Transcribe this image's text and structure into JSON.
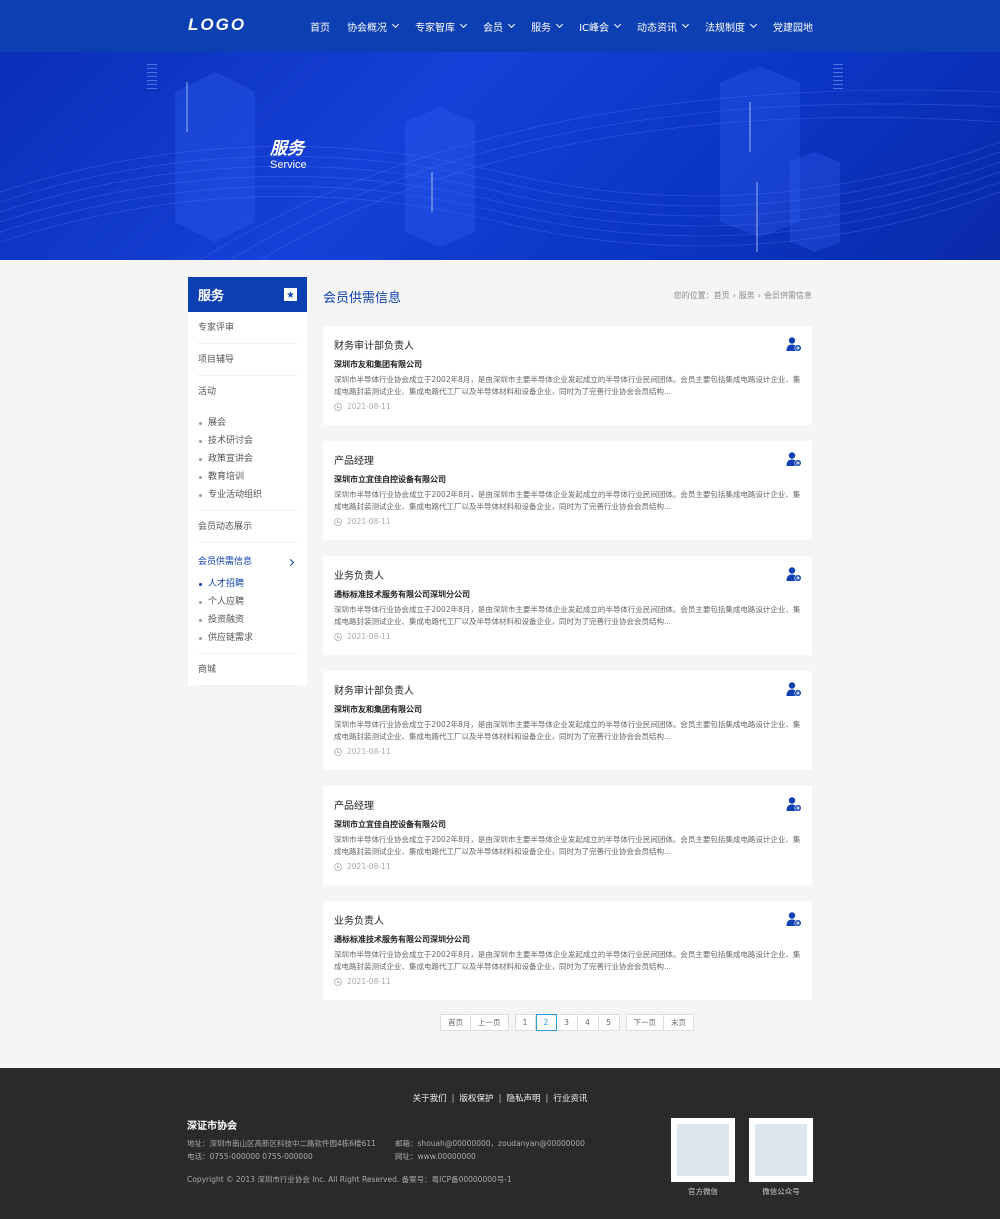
{
  "header": {
    "logo": "LOGO",
    "nav": [
      {
        "label": "首页",
        "has_dropdown": false
      },
      {
        "label": "协会概况",
        "has_dropdown": true
      },
      {
        "label": "专家智库",
        "has_dropdown": true
      },
      {
        "label": "会员",
        "has_dropdown": true
      },
      {
        "label": "服务",
        "has_dropdown": true
      },
      {
        "label": "IC峰会",
        "has_dropdown": true
      },
      {
        "label": "动态资讯",
        "has_dropdown": true
      },
      {
        "label": "法规制度",
        "has_dropdown": true
      },
      {
        "label": "党建园地",
        "has_dropdown": false
      }
    ]
  },
  "banner": {
    "title": "服务",
    "subtitle": "Service"
  },
  "sidebar": {
    "title": "服务",
    "items": [
      {
        "label": "专家评审"
      },
      {
        "label": "项目辅导"
      },
      {
        "label": "活动"
      }
    ],
    "activity_subitems": [
      "展会",
      "技术研讨会",
      "政策宣讲会",
      "教育培训",
      "专业活动组织"
    ],
    "member_dynamic": "会员动态展示",
    "member_supply": "会员供需信息",
    "supply_subitems": [
      {
        "label": "人才招聘",
        "active": true
      },
      {
        "label": "个人应聘",
        "active": false
      },
      {
        "label": "投资融资",
        "active": false
      },
      {
        "label": "供应链需求",
        "active": false
      }
    ],
    "mall": "商城"
  },
  "main": {
    "title": "会员供需信息",
    "breadcrumb": {
      "prefix": "您的位置：",
      "items": [
        "首页",
        "服务",
        "会员供需信息"
      ]
    },
    "posts": [
      {
        "title": "财务审计部负责人",
        "company": "深圳市友和集团有限公司",
        "desc": "深圳市半导体行业协会成立于2002年8月，是由深圳市主要半导体企业发起成立的半导体行业民间团体。会员主要包括集成电路设计企业、集成电路封装测试企业、集成电路代工厂以及半导体材料和设备企业，同时为了完善行业协会会员结构...",
        "date": "2021-08-11"
      },
      {
        "title": "产品经理",
        "company": "深圳市立宜佳自控设备有限公司",
        "desc": "深圳市半导体行业协会成立于2002年8月，是由深圳市主要半导体企业发起成立的半导体行业民间团体。会员主要包括集成电路设计企业、集成电路封装测试企业、集成电路代工厂以及半导体材料和设备企业，同时为了完善行业协会会员结构...",
        "date": "2021-08-11"
      },
      {
        "title": "业务负责人",
        "company": "通标标准技术服务有限公司深圳分公司",
        "desc": "深圳市半导体行业协会成立于2002年8月，是由深圳市主要半导体企业发起成立的半导体行业民间团体。会员主要包括集成电路设计企业、集成电路封装测试企业、集成电路代工厂以及半导体材料和设备企业，同时为了完善行业协会会员结构...",
        "date": "2021-08-11"
      },
      {
        "title": "财务审计部负责人",
        "company": "深圳市友和集团有限公司",
        "desc": "深圳市半导体行业协会成立于2002年8月，是由深圳市主要半导体企业发起成立的半导体行业民间团体。会员主要包括集成电路设计企业、集成电路封装测试企业、集成电路代工厂以及半导体材料和设备企业，同时为了完善行业协会会员结构...",
        "date": "2021-08-11"
      },
      {
        "title": "产品经理",
        "company": "深圳市立宜佳自控设备有限公司",
        "desc": "深圳市半导体行业协会成立于2002年8月，是由深圳市主要半导体企业发起成立的半导体行业民间团体。会员主要包括集成电路设计企业、集成电路封装测试企业、集成电路代工厂以及半导体材料和设备企业，同时为了完善行业协会会员结构...",
        "date": "2021-08-11"
      },
      {
        "title": "业务负责人",
        "company": "通标标准技术服务有限公司深圳分公司",
        "desc": "深圳市半导体行业协会成立于2002年8月，是由深圳市主要半导体企业发起成立的半导体行业民间团体。会员主要包括集成电路设计企业、集成电路封装测试企业、集成电路代工厂以及半导体材料和设备企业，同时为了完善行业协会会员结构...",
        "date": "2021-08-11"
      }
    ],
    "icon": "user-add-icon"
  },
  "pagination": {
    "first": "首页",
    "prev": "上一页",
    "pages": [
      "1",
      "2",
      "3",
      "4",
      "5"
    ],
    "current": "2",
    "next": "下一页",
    "last": "末页"
  },
  "footer": {
    "links": [
      "关于我们",
      "版权保护",
      "隐私声明",
      "行业资讯"
    ],
    "org_name": "深证市协会",
    "address": "地址：深圳市南山区高新区科技中二路软件园4栋6楼611",
    "phone": "电话：0755-000000 0755-000000",
    "email": "邮箱：shouah@00000000，zoudanyan@00000000",
    "website": "网址：www.00000000",
    "copyright": "Copyright © 2013 深圳市行业协会 Inc.  All Right Reserved. 备案号：粤ICP备00000000号-1",
    "qr_codes": [
      {
        "label": "官方微信"
      },
      {
        "label": "微信公众号"
      }
    ]
  },
  "colors": {
    "brand_blue": "#0c3fb2",
    "footer_bg": "#2a2a2a",
    "page_active": "#2a9dd8"
  }
}
